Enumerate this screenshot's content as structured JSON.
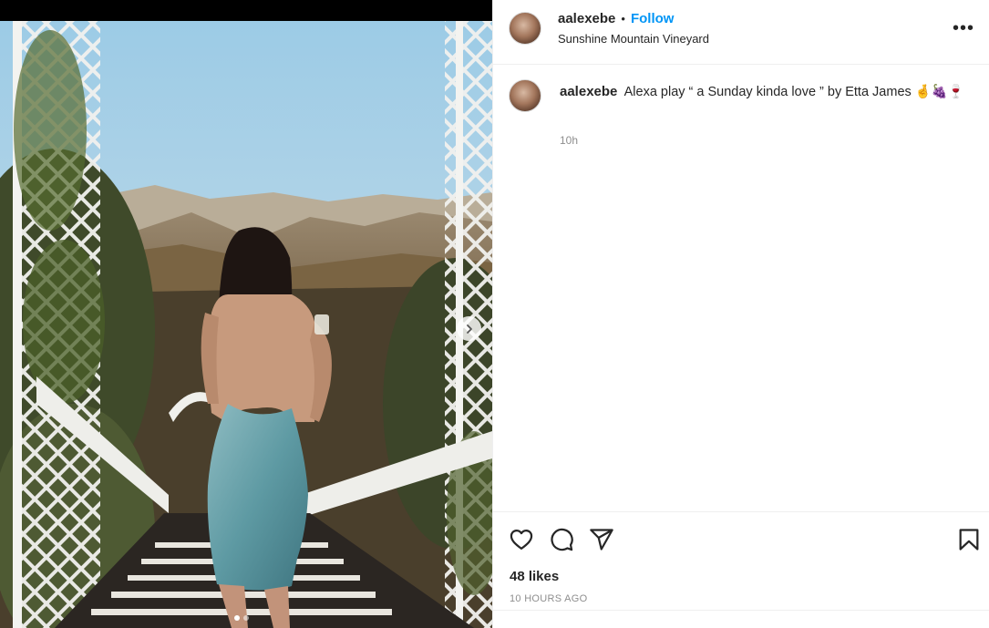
{
  "post": {
    "username": "aalexebe",
    "separator": "•",
    "follow_label": "Follow",
    "location": "Sunshine Mountain Vineyard",
    "more_label": "•••"
  },
  "caption": {
    "username": "aalexebe",
    "text": "Alexa play “ a Sunday kinda love ” by Etta James 🤞🍇🍷",
    "time": "10h"
  },
  "stats": {
    "likes": "48 likes",
    "posted_ago": "10 HOURS AGO"
  },
  "carousel": {
    "slides": 2,
    "active_slide": 1
  },
  "icons": {
    "like": "heart-icon",
    "comment": "comment-icon",
    "share": "paper-plane-icon",
    "save": "bookmark-icon",
    "next": "chevron-right-icon",
    "more": "more-options-icon"
  },
  "colors": {
    "accent": "#0095f6",
    "text": "#262626",
    "muted": "#8e8e8e",
    "border": "#efefef"
  }
}
